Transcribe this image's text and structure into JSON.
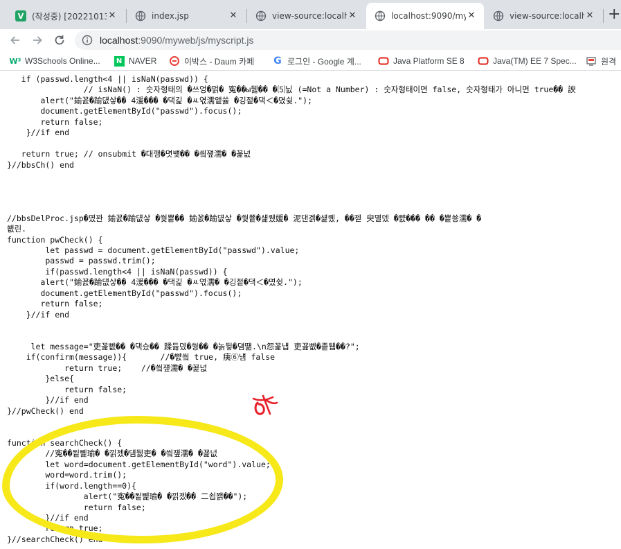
{
  "tabs": [
    {
      "title": "(작성중) [20221013/",
      "icon": "v-app-icon",
      "active": false
    },
    {
      "title": "index.jsp",
      "icon": "globe-icon",
      "active": false
    },
    {
      "title": "view-source:localho",
      "icon": "globe-icon",
      "active": false
    },
    {
      "title": "localhost:9090/myw",
      "icon": "globe-icon",
      "active": true
    },
    {
      "title": "view-source:localho",
      "icon": "globe-icon",
      "active": false
    }
  ],
  "new_tab_label": "+",
  "address": {
    "host": "localhost",
    "path": ":9090/myweb/js/myscript.js"
  },
  "bookmarks": [
    {
      "label": "W3Schools Online...",
      "icon": "w3schools-icon"
    },
    {
      "label": "NAVER",
      "icon": "naver-icon"
    },
    {
      "label": "이박스 - Daum 카페",
      "icon": "daum-cafe-icon"
    },
    {
      "label": "로그인 - Google 계...",
      "icon": "google-icon"
    },
    {
      "label": "Java Platform SE 8",
      "icon": "oracle-icon"
    },
    {
      "label": "Java(TM) EE 7 Spec...",
      "icon": "oracle-icon"
    },
    {
      "label": "원격",
      "icon": "remote-icon"
    }
  ],
  "code_lines": [
    "   if (passwd.length<4 || isNaN(passwd)) {",
    "                // isNaN() : 숫자형태의 �쓰엉�멁� 寃��ы뒗�� �⑸닔 (=Not a Number) : 숫자형태이면 false, 숫자형태가 아니면 true�� 諛",
    "       alert(\"鍮꾨�踰덊샇�� 4湲��� �댁긽 �ㅻ엯濡앹쓣 �깅젙�댁＜�몄슂.\");",
    "       document.getElementById(\"passwd\").focus();",
    "       return false;",
    "    }//if end",
    "",
    "   return true; // onsubmit �대깽�몃뱾�� �씤쟾濡� �꾩넚",
    "}//bbsCh() end",
    "",
    "",
    "",
    "",
    "//bbsDelProc.jsp�몄꽌 鍮꾨�踰덊샇 �쒖뿉�� 鍮꾨�踰덊샇 �쒖쭅�섍퀬媛� 泥댄겕�섍퀬, ��젣 臾멸뎄 �뺤��� �� �뿉쑝濡� �",
    "쐢린.",
    "function pwCheck() {",
    "        let passwd = document.getElementById(\"passwd\").value;",
    "        passwd = passwd.trim();",
    "        if(passwd.length<4 || isNaN(passwd)) {",
    "       alert(\"鍮꾨�踰덊샇�� 4湲��� �댁긽 �ㅻ엯濡� �깅젙�댁＜�몄슂.\");",
    "       document.getElementById(\"passwd\").focus();",
    "       return false;",
    "    }//if end",
    "",
    "",
    "     let message=\"吏꾪뻾�� �댁슜�� 蹂듦뎄�쒕�� �놁뒿�덈떎.\\n怨꾩냽 吏꾪뻾�좉퉴��?\";",
    "    if(confirm(message)){       //�뺤씤 true, 痍⑥냼 false",
    "            return true;    //�씤쟾濡� �꾩넚",
    "        }else{",
    "            return false;",
    "        }//if end",
    "}//pwCheck() end",
    "",
    "",
    "function searchCheck() {",
    "        //寃��됱뼱瑜� �낅젰�덈뒗吏� �씤쟾濡� �꾩넚",
    "        let word=document.getElementById(\"word\").value;",
    "        word=word.trim();",
    "        if(word.length==0){",
    "                alert(\"寃��됱뼱瑜� �낅젰�� 二쇱꽭��\");",
    "                return false;",
    "        }//if end",
    "        return true;",
    "}//searchCheck() end"
  ],
  "annotation_colors": {
    "highlight": "#f7e81a",
    "pen_mark": "#e8202a"
  }
}
